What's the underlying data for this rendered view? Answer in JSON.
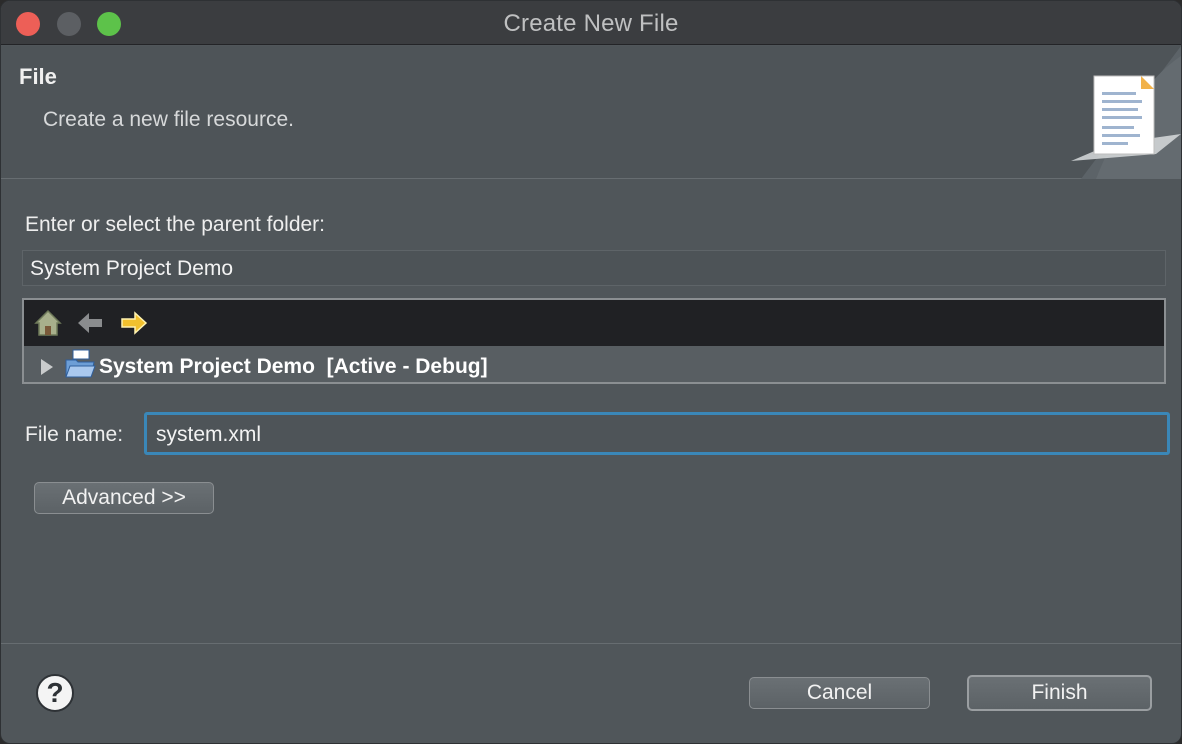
{
  "window": {
    "title": "Create New File"
  },
  "header": {
    "title": "File",
    "description": "Create a new file resource."
  },
  "parent_folder": {
    "label": "Enter or select the parent folder:",
    "value": "System Project Demo"
  },
  "tree": {
    "toolbar_icons": [
      "home-icon",
      "back-arrow-icon",
      "forward-arrow-icon"
    ],
    "items": [
      {
        "label": "System Project Demo  [Active - Debug]",
        "icon": "project-folder-icon",
        "expanded": false
      }
    ]
  },
  "file_name": {
    "label": "File name:",
    "value": "system.xml"
  },
  "buttons": {
    "advanced": "Advanced >>",
    "cancel": "Cancel",
    "finish": "Finish",
    "help": "?"
  },
  "colors": {
    "focus_ring": "#3a87b8",
    "close": "#ed5f57",
    "maximize": "#5dc24a"
  }
}
